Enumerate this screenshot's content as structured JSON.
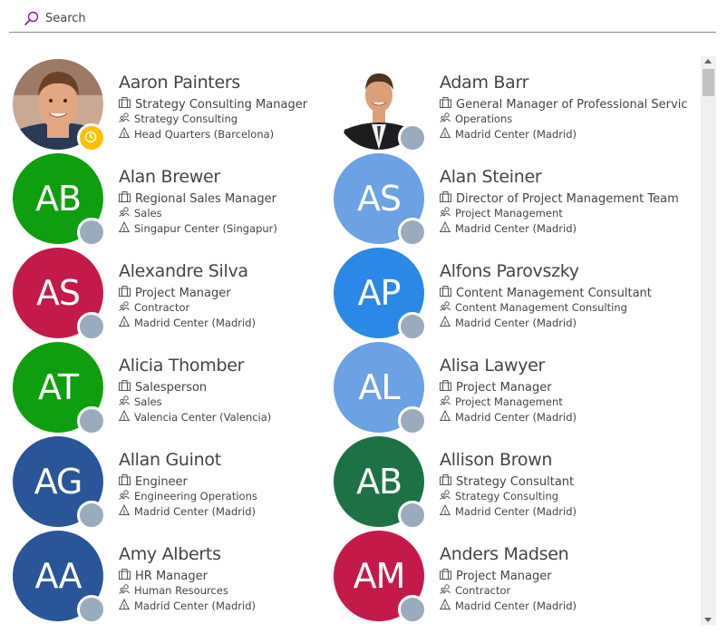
{
  "search": {
    "placeholder": "Search"
  },
  "people": [
    {
      "name": "Aaron Painters",
      "title": "Strategy Consulting Manager",
      "department": "Strategy Consulting",
      "location": "Head Quarters (Barcelona)",
      "photo": "man-photo-1",
      "presence": "away"
    },
    {
      "name": "Adam Barr",
      "title": "General Manager of Professional Servic",
      "department": "Operations",
      "location": "Madrid Center (Madrid)",
      "photo": "man-photo-2",
      "presence": "offline"
    },
    {
      "name": "Alan Brewer",
      "initials": "AB",
      "color": "#0f9e0f",
      "title": "Regional Sales Manager",
      "department": "Sales",
      "location": "Singapur Center (Singapur)",
      "presence": "offline"
    },
    {
      "name": "Alan Steiner",
      "initials": "AS",
      "color": "#6ca1e4",
      "title": "Director of Project Management Team",
      "department": "Project Management",
      "location": "Madrid Center (Madrid)",
      "presence": "offline"
    },
    {
      "name": "Alexandre Silva",
      "initials": "AS",
      "color": "#c41a4a",
      "title": "Project Manager",
      "department": "Contractor",
      "location": "Madrid Center (Madrid)",
      "presence": "offline"
    },
    {
      "name": "Alfons Parovszky",
      "initials": "AP",
      "color": "#2b88e6",
      "title": "Content Management Consultant",
      "department": "Content Management Consulting",
      "location": "Madrid Center (Madrid)",
      "presence": "offline"
    },
    {
      "name": "Alicia Thomber",
      "initials": "AT",
      "color": "#0f9e0f",
      "title": "Salesperson",
      "department": "Sales",
      "location": "Valencia Center (Valencia)",
      "presence": "offline"
    },
    {
      "name": "Alisa Lawyer",
      "initials": "AL",
      "color": "#6ca1e4",
      "title": "Project Manager",
      "department": "Project Management",
      "location": "Madrid Center (Madrid)",
      "presence": "offline"
    },
    {
      "name": "Allan Guinot",
      "initials": "AG",
      "color": "#2a5599",
      "title": "Engineer",
      "department": "Engineering Operations",
      "location": "Madrid Center (Madrid)",
      "presence": "offline"
    },
    {
      "name": "Allison Brown",
      "initials": "AB",
      "color": "#1e7145",
      "title": "Strategy Consultant",
      "department": "Strategy Consulting",
      "location": "Madrid Center (Madrid)",
      "presence": "offline"
    },
    {
      "name": "Amy Alberts",
      "initials": "AA",
      "color": "#2a5599",
      "title": "HR Manager",
      "department": "Human Resources",
      "location": "Madrid Center (Madrid)",
      "presence": "offline"
    },
    {
      "name": "Anders Madsen",
      "initials": "AM",
      "color": "#c41a4a",
      "title": "Project Manager",
      "department": "Contractor",
      "location": "Madrid Center (Madrid)",
      "presence": "offline"
    }
  ],
  "icons": {
    "search": "search-icon",
    "title": "briefcase-icon",
    "department": "people-icon",
    "location": "building-icon",
    "away": "clock-icon"
  },
  "colors": {
    "accent": "#881798",
    "away": "#ffc000",
    "offline": "#9aabbd"
  }
}
